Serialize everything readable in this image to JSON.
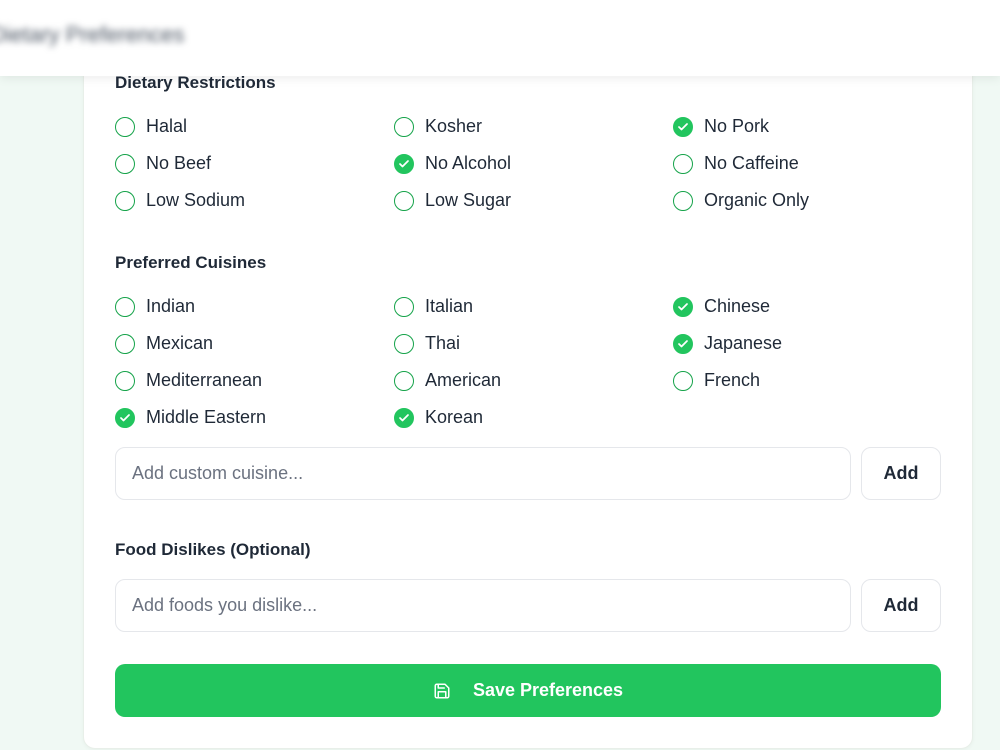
{
  "header": {
    "title": "Dietary Preferences"
  },
  "dietary_restrictions": {
    "title": "Dietary Restrictions",
    "options": [
      {
        "label": "Halal",
        "checked": false
      },
      {
        "label": "Kosher",
        "checked": false
      },
      {
        "label": "No Pork",
        "checked": true
      },
      {
        "label": "No Beef",
        "checked": false
      },
      {
        "label": "No Alcohol",
        "checked": true
      },
      {
        "label": "No Caffeine",
        "checked": false
      },
      {
        "label": "Low Sodium",
        "checked": false
      },
      {
        "label": "Low Sugar",
        "checked": false
      },
      {
        "label": "Organic Only",
        "checked": false
      }
    ]
  },
  "preferred_cuisines": {
    "title": "Preferred Cuisines",
    "options": [
      {
        "label": "Indian",
        "checked": false
      },
      {
        "label": "Italian",
        "checked": false
      },
      {
        "label": "Chinese",
        "checked": true
      },
      {
        "label": "Mexican",
        "checked": false
      },
      {
        "label": "Thai",
        "checked": false
      },
      {
        "label": "Japanese",
        "checked": true
      },
      {
        "label": "Mediterranean",
        "checked": false
      },
      {
        "label": "American",
        "checked": false
      },
      {
        "label": "French",
        "checked": false
      },
      {
        "label": "Middle Eastern",
        "checked": true
      },
      {
        "label": "Korean",
        "checked": true
      }
    ],
    "custom_input": {
      "placeholder": "Add custom cuisine...",
      "value": ""
    },
    "add_label": "Add"
  },
  "food_dislikes": {
    "title": "Food Dislikes (Optional)",
    "input": {
      "placeholder": "Add foods you dislike...",
      "value": ""
    },
    "add_label": "Add"
  },
  "save_button": {
    "label": "Save Preferences",
    "icon": "save-icon"
  },
  "colors": {
    "accent": "#22c55e",
    "border": "#e5e7eb",
    "background": "#f0f9f4"
  }
}
